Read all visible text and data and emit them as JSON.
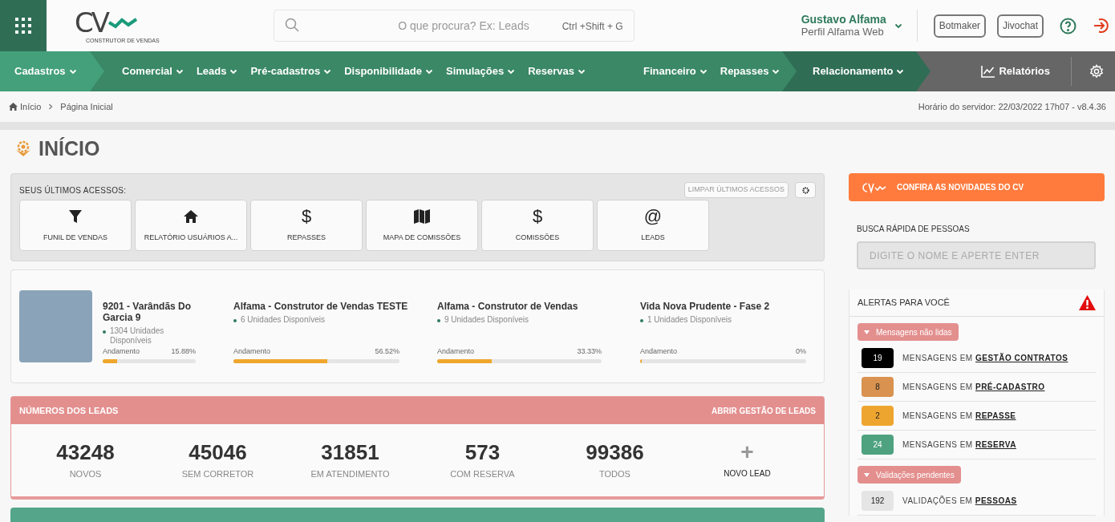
{
  "header": {
    "logo": {
      "text": "CV",
      "tagline": "CONSTRUTOR DE VENDAS"
    },
    "search": {
      "placeholder": "O que procura? Ex: Leads",
      "shortcut": "Ctrl +Shift + G"
    },
    "user": {
      "name": "Gustavo Alfama",
      "profile": "Perfil Alfama Web"
    },
    "buttons": [
      "Botmaker",
      "Jivochat"
    ]
  },
  "nav": [
    {
      "kind": "light",
      "items": [
        "Cadastros"
      ]
    },
    {
      "kind": "mid",
      "items": [
        "Comercial",
        "Leads",
        "Pré-cadastros",
        "Disponibilidade",
        "Simulações",
        "Reservas"
      ]
    },
    {
      "kind": "mid",
      "items": [
        "Financeiro",
        "Repasses"
      ]
    },
    {
      "kind": "dark",
      "items": [
        "Relacionamento"
      ]
    },
    {
      "kind": "gray",
      "items": [
        "Relatórios"
      ]
    }
  ],
  "breadcrumb": [
    "Início",
    "Página Inicial"
  ],
  "server_time": "Horário do servidor: 22/03/2022 17h07 - v8.4.36",
  "page_title": "INÍCIO",
  "recent": {
    "title": "SEUS ÚLTIMOS ACESSOS:",
    "clear_button": "LIMPAR ÚLTIMOS ACESSOS",
    "items": [
      {
        "kind": "filter",
        "label": "FUNIL DE VENDAS"
      },
      {
        "kind": "home",
        "label": "RELATÓRIO USUÁRIOS A..."
      },
      {
        "kind": "glyph",
        "icon": "$",
        "label": "REPASSES"
      },
      {
        "kind": "map",
        "label": "MAPA DE COMISSÕES"
      },
      {
        "kind": "glyph",
        "icon": "$",
        "label": "COMISSÕES"
      },
      {
        "kind": "glyph",
        "icon": "@",
        "label": "LEADS"
      }
    ]
  },
  "projects": [
    {
      "name": "9201 - Varândãs Do Garcia 9",
      "units": "1304 Unidades Disponíveis",
      "progress_label": "Andamento",
      "percent": "15.88%",
      "level": 0.1588
    },
    {
      "name": "Alfama - Construtor de Vendas TESTE",
      "units": "6 Unidades Disponíveis",
      "progress_label": "Andamento",
      "percent": "56.52%",
      "level": 0.5652
    },
    {
      "name": "Alfama - Construtor de Vendas",
      "units": "9 Unidades Disponíveis",
      "progress_label": "Andamento",
      "percent": "33.33%",
      "level": 0.3333
    },
    {
      "name": "Vida Nova Prudente - Fase 2",
      "units": "1 Unidades Disponíveis",
      "progress_label": "Andamento",
      "percent": "0%",
      "level": 0
    }
  ],
  "leads": {
    "title": "NÚMEROS DOS LEADS",
    "link": "ABRIR GESTÃO DE LEADS",
    "stats": [
      {
        "value": "43248",
        "label": "NOVOS"
      },
      {
        "value": "45046",
        "label": "SEM CORRETOR"
      },
      {
        "value": "31851",
        "label": "EM ATENDIMENTO"
      },
      {
        "value": "573",
        "label": "COM RESERVA"
      },
      {
        "value": "99386",
        "label": "TODOS"
      }
    ],
    "new_button": {
      "icon": "+",
      "label": "NOVO LEAD"
    }
  },
  "news_banner": "CONFIRA AS NOVIDADES DO CV",
  "quick_search": {
    "label": "BUSCA RÁPIDA DE PESSOAS",
    "placeholder": "DIGITE O NOME E APERTE ENTER"
  },
  "alerts": {
    "title": "ALERTAS PARA VOCÊ",
    "groups": [
      {
        "title": "Mensagens não lidas",
        "expanded": true,
        "items": [
          {
            "count": "19",
            "color": "#000000",
            "prefix": "MENSAGENS EM",
            "link": "GESTÃO CONTRATOS"
          },
          {
            "count": "8",
            "color": "#d9924f",
            "prefix": "MENSAGENS EM",
            "link": "PRÉ-CADASTRO"
          },
          {
            "count": "2",
            "color": "#eea52f",
            "prefix": "MENSAGENS EM",
            "link": "REPASSE"
          },
          {
            "count": "24",
            "color": "#4ea27f",
            "prefix": "MENSAGENS EM",
            "link": "RESERVA"
          }
        ]
      },
      {
        "title": "Validações pendentes",
        "expanded": true,
        "items": [
          {
            "count": "192",
            "color": "#e5e5e5",
            "prefix": "VALIDAÇÕES EM",
            "link": "PESSOAS"
          }
        ]
      }
    ]
  }
}
